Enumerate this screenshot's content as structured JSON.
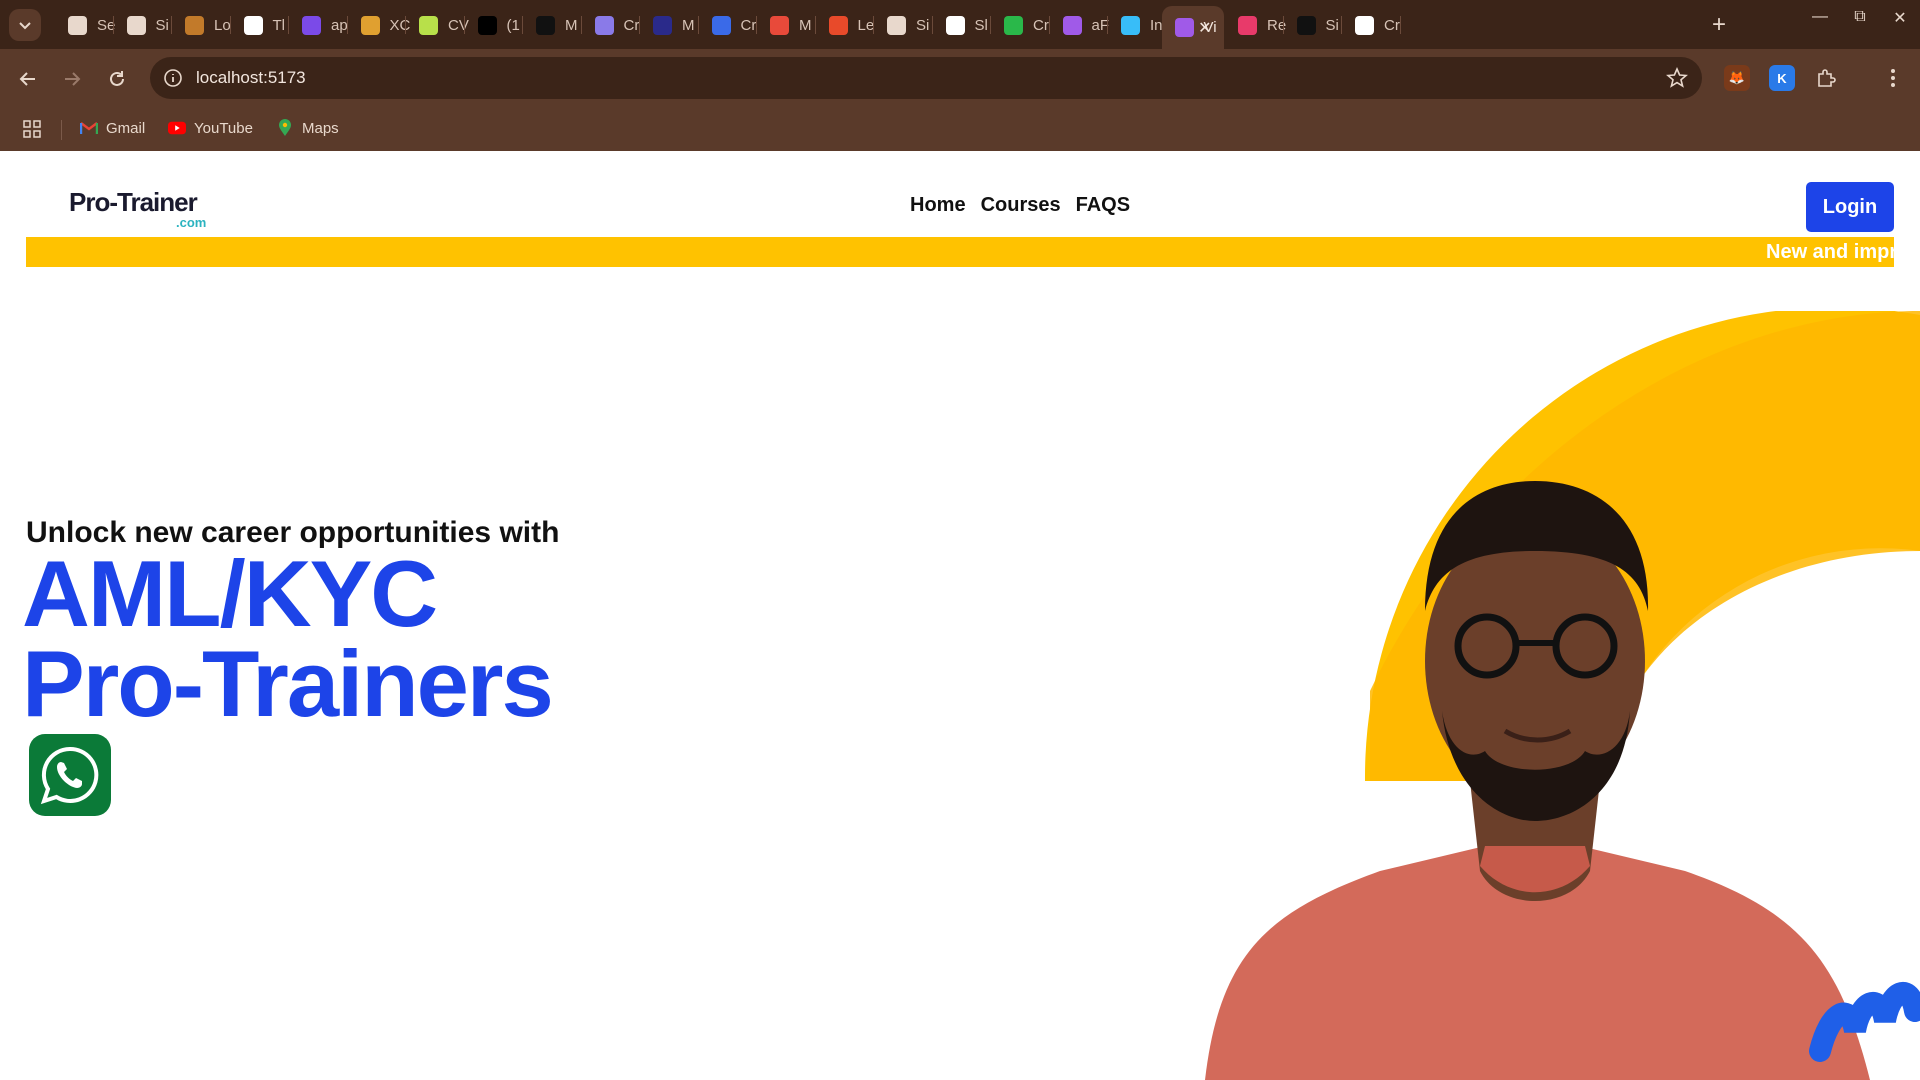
{
  "browser": {
    "tabs": [
      {
        "label": "Se",
        "icon": "gear-icon",
        "color": "#e8d8cc"
      },
      {
        "label": "Si",
        "icon": "globe-icon",
        "color": "#e8d8cc"
      },
      {
        "label": "Lo",
        "icon": "circle-logo-icon",
        "color": "#c27a2a"
      },
      {
        "label": "Tl",
        "icon": "octopus-icon",
        "color": "#ffffff"
      },
      {
        "label": "ap",
        "icon": "app-logo-icon",
        "color": "#7b4ae8"
      },
      {
        "label": "XC",
        "icon": "x-cross-icon",
        "color": "#e0a030"
      },
      {
        "label": "CV",
        "icon": "cv-logo-icon",
        "color": "#b8e04a"
      },
      {
        "label": "(1",
        "icon": "x-twitter-icon",
        "color": "#000000"
      },
      {
        "label": "M",
        "icon": "m-logo-icon",
        "color": "#111111"
      },
      {
        "label": "Cr",
        "icon": "floppy-icon",
        "color": "#8a7ae8"
      },
      {
        "label": "M",
        "icon": "ring-logo-icon",
        "color": "#2a2a8a"
      },
      {
        "label": "Cr",
        "icon": "api-icon",
        "color": "#3a6ae8"
      },
      {
        "label": "M",
        "icon": "gmail-m-icon",
        "color": "#e84a3a"
      },
      {
        "label": "Le",
        "icon": "m-orange-icon",
        "color": "#e84a2a"
      },
      {
        "label": "Si",
        "icon": "globe-icon",
        "color": "#e8d8cc"
      },
      {
        "label": "Sl",
        "icon": "github-icon",
        "color": "#ffffff"
      },
      {
        "label": "Cr",
        "icon": "c-logo-icon",
        "color": "#2ab84a"
      },
      {
        "label": "aF",
        "icon": "command-icon",
        "color": "#a05ae8"
      },
      {
        "label": "In",
        "icon": "tailwind-icon",
        "color": "#38bdf8"
      },
      {
        "label": "Vi",
        "icon": "vite-icon",
        "color": "#a05ae8",
        "active": true
      },
      {
        "label": "Re",
        "icon": "react-icon",
        "color": "#e83a6a"
      },
      {
        "label": "Si",
        "icon": "shadcn-icon",
        "color": "#111111"
      },
      {
        "label": "Cr",
        "icon": "github-icon",
        "color": "#ffffff"
      }
    ],
    "url": "localhost:5173",
    "bookmarks": [
      {
        "label": "Gmail",
        "icon": "gmail-icon"
      },
      {
        "label": "YouTube",
        "icon": "youtube-icon"
      },
      {
        "label": "Maps",
        "icon": "maps-pin-icon"
      }
    ],
    "extensions": [
      {
        "icon": "fox-extension-icon",
        "color": "#e87a2a"
      },
      {
        "icon": "k-extension-icon",
        "color": "#2a7ae8",
        "letter": "K"
      }
    ]
  },
  "site": {
    "logo": {
      "name": "Pro-Trainer",
      "domain": ".com"
    },
    "nav": [
      "Home",
      "Courses",
      "FAQS"
    ],
    "login_label": "Login",
    "ticker_text": "New and impr",
    "hero": {
      "subtitle": "Unlock new career opportunities with",
      "title_line1": "AML/KYC",
      "title_line2": "Pro-Trainers"
    },
    "colors": {
      "brand_blue": "#1d44e8",
      "ticker_yellow": "#ffc200",
      "whatsapp_green": "#0b7a38"
    }
  }
}
